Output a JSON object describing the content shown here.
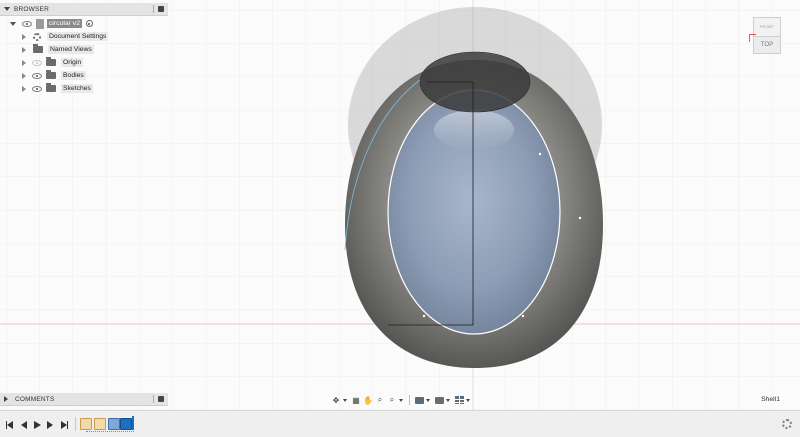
{
  "browser": {
    "title": "BROWSER",
    "document_name": "circular v2",
    "items": [
      {
        "label": "Document Settings",
        "icon": "gear-icon"
      },
      {
        "label": "Named Views",
        "icon": "folder-icon"
      },
      {
        "label": "Origin",
        "icon": "folder-icon",
        "visible": false
      },
      {
        "label": "Bodies",
        "icon": "folder-icon",
        "visible": true
      },
      {
        "label": "Sketches",
        "icon": "folder-icon",
        "visible": true
      }
    ]
  },
  "viewcube": {
    "front_label": "TOP",
    "top_label": "FRONT"
  },
  "comments": {
    "title": "COMMENTS"
  },
  "status": {
    "active_feature": "Shell1"
  },
  "colors": {
    "grid": "#dedede",
    "x_axis": "#e8a7a7",
    "body_shell": "#7c7c7a",
    "inner_face": "#93a4bd",
    "selection_edge": "#ffffff",
    "sketch_line": "#1e1e1e",
    "timeline_active": "#1f6fbf"
  }
}
